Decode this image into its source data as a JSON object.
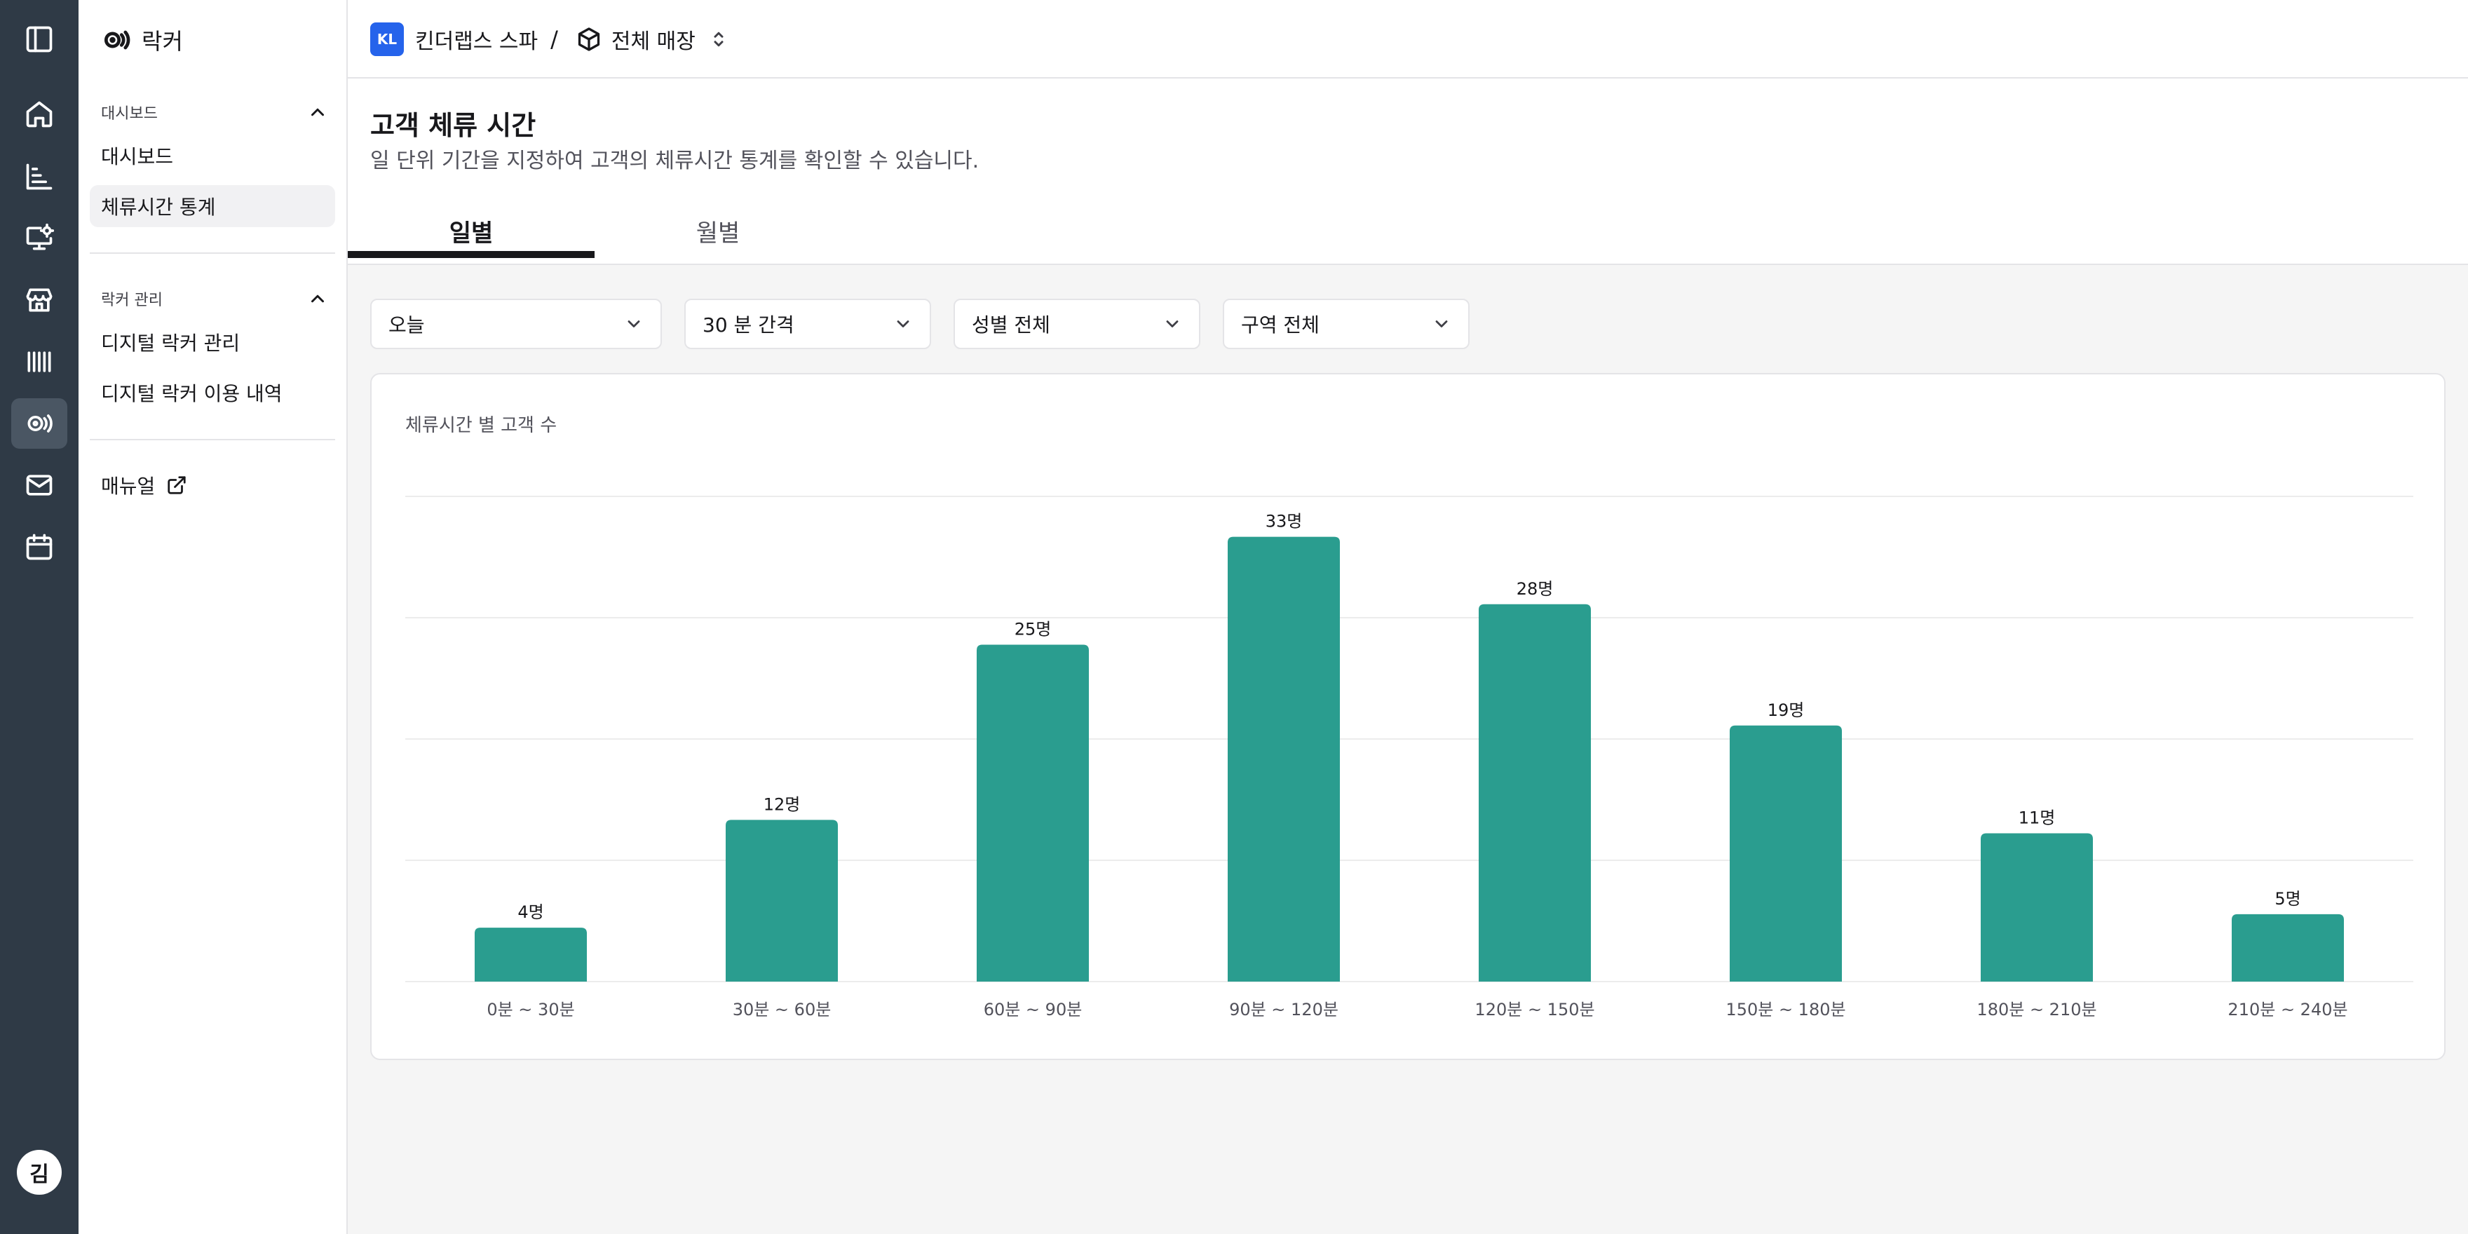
{
  "app": {
    "name": "락커",
    "user_initial": "김"
  },
  "rail": {
    "items": [
      "sidebar-toggle-icon",
      "home-icon",
      "chart-icon",
      "monitor-settings-icon",
      "store-icon",
      "barcode-icon",
      "locker-icon",
      "mail-icon",
      "calendar-icon"
    ],
    "active_item": "locker-icon"
  },
  "sidebar": {
    "group1": {
      "label": "대시보드",
      "items": [
        {
          "label": "대시보드",
          "active": false
        },
        {
          "label": "체류시간 통계",
          "active": true
        }
      ]
    },
    "group2": {
      "label": "락커 관리",
      "items": [
        {
          "label": "디지털 락커 관리",
          "active": false
        },
        {
          "label": "디지털 락커 이용 내역",
          "active": false
        }
      ]
    },
    "manual_label": "매뉴얼"
  },
  "topbar": {
    "org_badge": "KL",
    "org_name": "킨더랩스 스파",
    "separator": "/",
    "store_name": "전체 매장"
  },
  "page": {
    "title": "고객 체류 시간",
    "description": "일 단위 기간을 지정하여 고객의 체류시간 통계를 확인할 수 있습니다.",
    "tabs": [
      {
        "label": "일별",
        "active": true
      },
      {
        "label": "월별",
        "active": false
      }
    ]
  },
  "filters": {
    "period": "오늘",
    "interval": "30 분 간격",
    "gender": "성별 전체",
    "zone": "구역 전체"
  },
  "chart_data": {
    "type": "bar",
    "title": "체류시간 별 고객 수",
    "categories": [
      "0분 ~ 30분",
      "30분 ~ 60분",
      "60분 ~ 90분",
      "90분 ~ 120분",
      "120분 ~ 150분",
      "150분 ~ 180분",
      "180분 ~ 210분",
      "210분 ~ 240분"
    ],
    "values": [
      4,
      12,
      25,
      33,
      28,
      19,
      11,
      5
    ],
    "value_suffix": "명",
    "ylim": [
      0,
      36
    ],
    "grid": true,
    "bar_color": "#2a9d8f"
  },
  "colors": {
    "rail_bg": "#2f3a46",
    "accent": "#2563eb",
    "bar": "#2a9d8f"
  }
}
